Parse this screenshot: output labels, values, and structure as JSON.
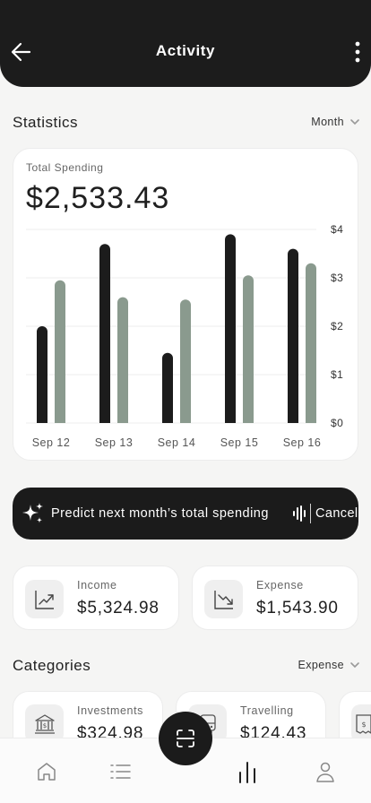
{
  "header": {
    "title": "Activity",
    "back_icon": "arrow-left-icon",
    "more_icon": "more-vertical-icon"
  },
  "statistics": {
    "title": "Statistics",
    "period": "Month",
    "card": {
      "label": "Total Spending",
      "total": "$2,533.43"
    }
  },
  "chart_data": {
    "type": "bar",
    "categories": [
      "Sep 12",
      "Sep 13",
      "Sep 14",
      "Sep 15",
      "Sep 16"
    ],
    "series": [
      {
        "values": [
          2.0,
          3.7,
          1.45,
          3.9,
          3.6
        ],
        "color": "#1c1c1c"
      },
      {
        "values": [
          2.95,
          2.6,
          2.55,
          3.05,
          3.3
        ],
        "color": "#8a9a8e"
      }
    ],
    "y_ticks": [
      "$0",
      "$1",
      "$2",
      "$3",
      "$4"
    ],
    "ylim": [
      0,
      4
    ],
    "grid": true,
    "y_axis_side": "right"
  },
  "predict": {
    "text": "Predict next month’s total spending",
    "cancel_label": "Cancel",
    "icon": "sparkles-icon"
  },
  "income": {
    "label": "Income",
    "value": "$5,324.98",
    "icon": "trend-up-icon"
  },
  "expense": {
    "label": "Expense",
    "value": "$1,543.90",
    "icon": "trend-down-icon"
  },
  "categories": {
    "title": "Categories",
    "filter": "Expense",
    "items": [
      {
        "label": "Investments",
        "value": "$324.98",
        "icon": "bank-icon"
      },
      {
        "label": "Travelling",
        "value": "$124.43",
        "icon": "bus-icon"
      },
      {
        "label": "",
        "value": "",
        "icon": "receipt-icon"
      }
    ]
  },
  "nav": {
    "items": [
      "home-icon",
      "list-icon",
      "scan-icon",
      "chart-icon",
      "user-icon"
    ]
  },
  "colors": {
    "dark": "#1b1b1b",
    "accent": "#8a9a8e",
    "background": "#f5f5f4"
  }
}
